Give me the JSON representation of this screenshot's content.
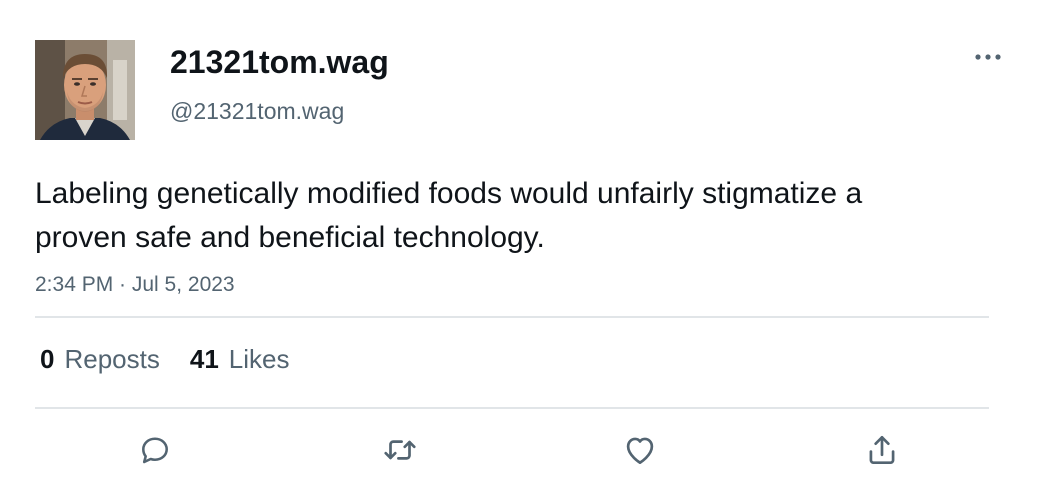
{
  "author": {
    "display_name": "21321tom.wag",
    "handle": "@21321tom.wag"
  },
  "post": {
    "text": "Labeling genetically modified foods would unfairly stigmatize a proven safe and beneficial technology.",
    "timestamp": "2:34 PM · Jul 5, 2023"
  },
  "stats": {
    "reposts_count": "0",
    "reposts_label": "Reposts",
    "likes_count": "41",
    "likes_label": "Likes"
  },
  "icons": {
    "more": "more-horizontal-icon",
    "reply": "reply-icon",
    "repost": "repost-icon",
    "like": "heart-icon",
    "share": "share-icon"
  },
  "colors": {
    "text_primary": "#0f1419",
    "text_secondary": "#536471",
    "divider": "#e1e5e8",
    "icon": "#536471"
  }
}
